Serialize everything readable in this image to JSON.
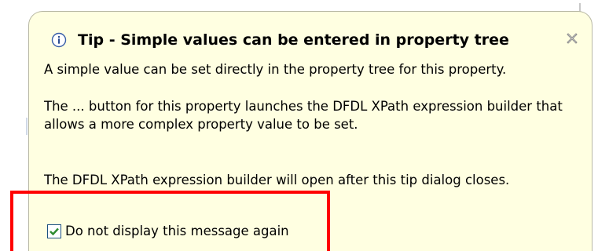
{
  "tip": {
    "title": "Tip - Simple values can be entered in property tree",
    "paragraph1": "A simple value can be set directly in the property tree for this property.",
    "paragraph2": "The ... button for this property launches the DFDL XPath expression builder that allows a more complex property value to be set.",
    "paragraph3": "The DFDL XPath expression builder will open after this tip dialog closes.",
    "checkbox_label": "Do not display this message again",
    "checkbox_checked": true,
    "info_icon": "info-icon",
    "close_icon": "close-icon"
  },
  "colors": {
    "tip_background": "#ffffe1",
    "highlight": "#ff0000",
    "check": "#2e8b2e"
  }
}
